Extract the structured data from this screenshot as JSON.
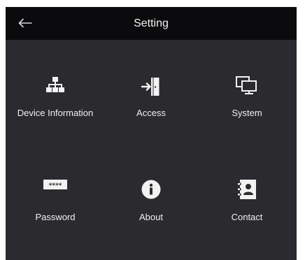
{
  "header": {
    "title": "Setting"
  },
  "tiles": [
    {
      "label": "Device Information",
      "icon": "network-tree-icon"
    },
    {
      "label": "Access",
      "icon": "door-entry-icon"
    },
    {
      "label": "System",
      "icon": "monitors-icon"
    },
    {
      "label": "Password",
      "icon": "password-dots-icon"
    },
    {
      "label": "About",
      "icon": "info-icon"
    },
    {
      "label": "Contact",
      "icon": "contact-book-icon"
    }
  ],
  "colors": {
    "background": "#2b2b2f",
    "header_background": "#0b0b0d",
    "text": "#ffffff"
  }
}
